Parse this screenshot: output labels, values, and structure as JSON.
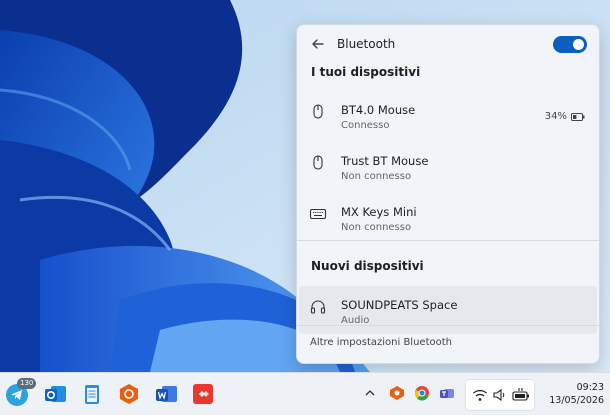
{
  "flyout": {
    "title": "Bluetooth",
    "toggle_on": true,
    "sections": {
      "my_devices": "I tuoi dispositivi",
      "new_devices": "Nuovi dispositivi"
    },
    "devices": [
      {
        "name": "BT4.0 Mouse",
        "status": "Connesso",
        "battery": "34%",
        "icon": "mouse-icon"
      },
      {
        "name": "Trust BT Mouse",
        "status": "Non connesso",
        "icon": "mouse-icon"
      },
      {
        "name": "MX Keys Mini",
        "status": "Non connesso",
        "icon": "keyboard-icon"
      }
    ],
    "new_devices": [
      {
        "name": "SOUNDPEATS Space",
        "status": "Audio",
        "icon": "headphones-icon"
      }
    ],
    "footer_link": "Altre impostazioni Bluetooth",
    "accent_color": "#0a5fc2"
  },
  "taskbar": {
    "apps": [
      {
        "name": "telegram-icon",
        "badge": "130"
      },
      {
        "name": "outlook-icon"
      },
      {
        "name": "notepad-icon"
      },
      {
        "name": "office-addin-icon"
      },
      {
        "name": "word-icon"
      },
      {
        "name": "anydesk-icon"
      }
    ],
    "tray": [
      "chevron-up-icon",
      "anydesk-tray-icon",
      "chrome-icon",
      "teams-icon",
      "wifi-icon",
      "volume-icon",
      "battery-plug-icon"
    ],
    "time": "09:23",
    "date": "13/05/2026"
  }
}
